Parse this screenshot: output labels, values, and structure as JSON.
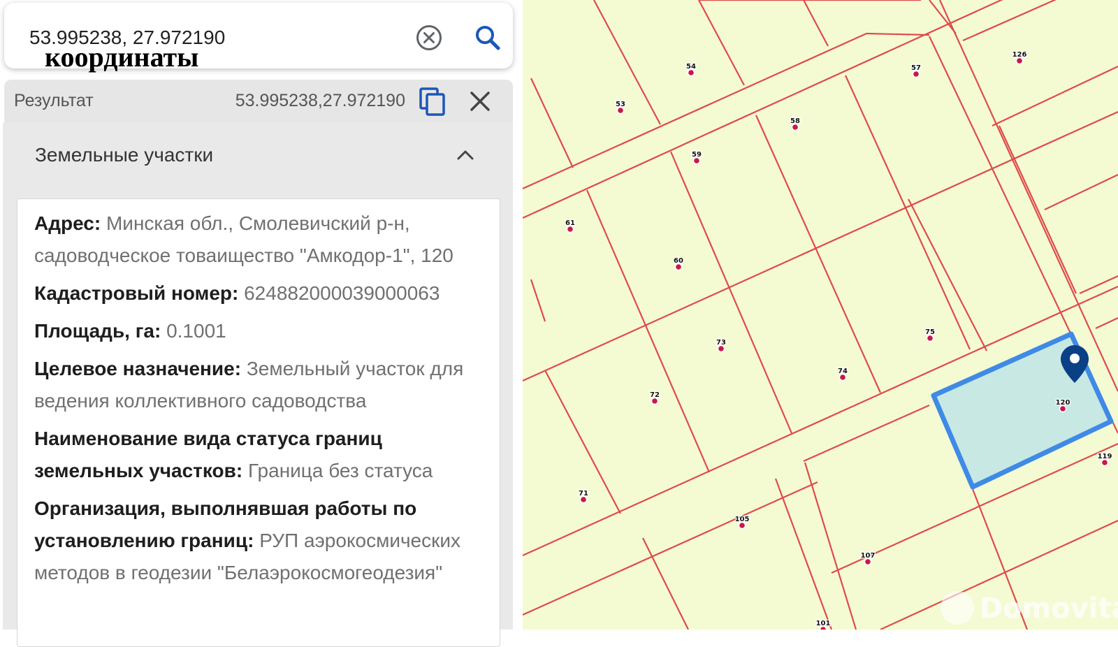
{
  "search": {
    "value": "53.995238, 27.972190",
    "overlay_label": "координаты"
  },
  "result": {
    "label": "Результат",
    "coords": "53.995238,27.972190"
  },
  "section": {
    "title": "Земельные участки"
  },
  "parcel": {
    "address_label": "Адрес:",
    "address_value": "Минская обл., Смолевичский р-н, садоводческое товаищество \"Амкодор-1\", 120",
    "cadastral_label": "Кадастровый номер:",
    "cadastral_value": "624882000039000063",
    "area_label": "Площадь, га:",
    "area_value": "0.1001",
    "purpose_label": "Целевое назначение:",
    "purpose_value": "Земельный участок для ведения коллективного садоводства",
    "boundary_label": "Наименование вида статуса границ земельных участков:",
    "boundary_value": "Граница без статуса",
    "org_label": "Организация, выполнявшая работы по установлению границ:",
    "org_value": "РУП аэрокосмических методов в геодезии \"Белаэрокосмогеодезия\""
  },
  "map": {
    "markers": [
      {
        "label": "53"
      },
      {
        "label": "54"
      },
      {
        "label": "57"
      },
      {
        "label": "126"
      },
      {
        "label": "58"
      },
      {
        "label": "59"
      },
      {
        "label": "61"
      },
      {
        "label": "60"
      },
      {
        "label": "73"
      },
      {
        "label": "75"
      },
      {
        "label": "74"
      },
      {
        "label": "72"
      },
      {
        "label": "120"
      },
      {
        "label": "119"
      },
      {
        "label": "71"
      },
      {
        "label": "105"
      },
      {
        "label": "107"
      },
      {
        "label": "101"
      }
    ],
    "watermark": "Domovita",
    "line_color": "#e04a4a",
    "selected_fill": "#c3e6e4",
    "selected_stroke": "#3f8ae6",
    "pin_color": "#0b3f86"
  }
}
